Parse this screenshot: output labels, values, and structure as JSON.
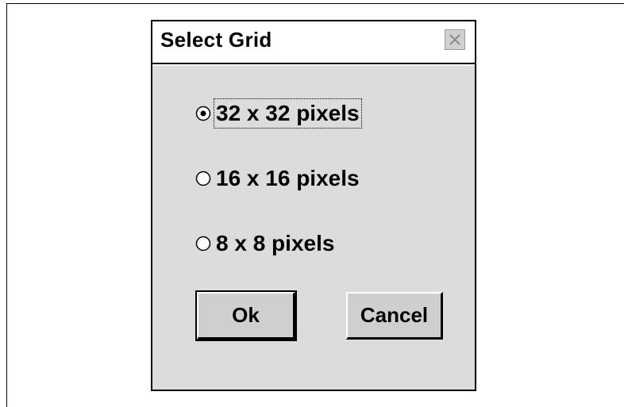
{
  "dialog": {
    "title": "Select Grid",
    "close_icon": "close-icon"
  },
  "options": [
    {
      "label": "32 x 32 pixels",
      "checked": true
    },
    {
      "label": "16 x 16 pixels",
      "checked": false
    },
    {
      "label": "8 x 8 pixels",
      "checked": false
    }
  ],
  "buttons": {
    "ok_label": "Ok",
    "cancel_label": "Cancel"
  }
}
